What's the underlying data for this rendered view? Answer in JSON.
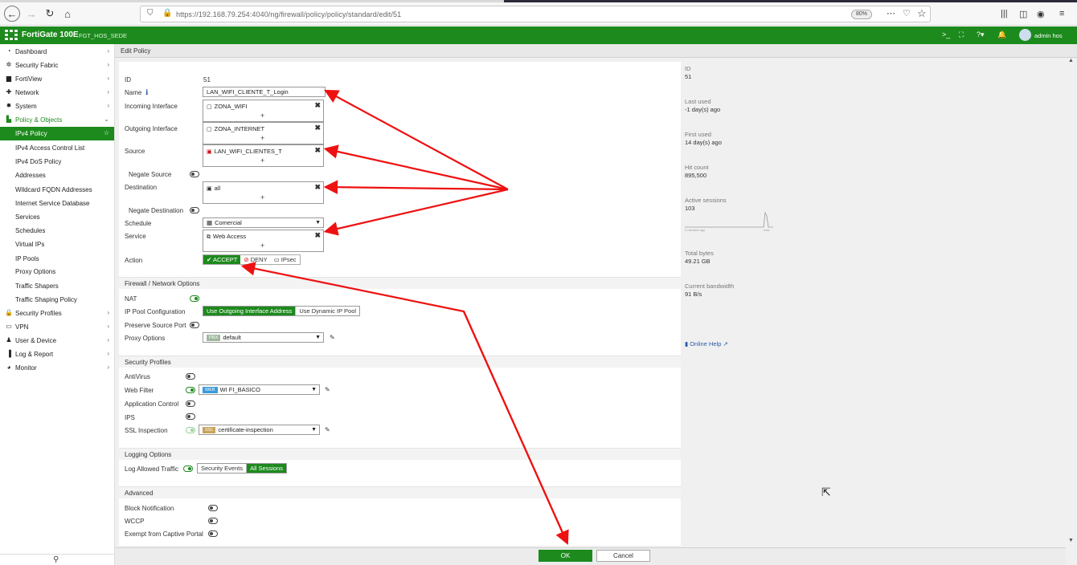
{
  "browser": {
    "url": "https://192.168.79.254:4040/ng/firewall/policy/policy/standard/edit/51",
    "zoom": "80%"
  },
  "header": {
    "model": "FortiGate 100E",
    "hostname": "FGT_HOS_SEDE",
    "user": "admin hos"
  },
  "sidebar": {
    "items": [
      {
        "label": "Dashboard",
        "icon": "dashboard-icon"
      },
      {
        "label": "Security Fabric",
        "icon": "fabric-icon"
      },
      {
        "label": "FortiView",
        "icon": "fortiview-icon"
      },
      {
        "label": "Network",
        "icon": "network-icon"
      },
      {
        "label": "System",
        "icon": "gear-icon"
      },
      {
        "label": "Policy & Objects",
        "icon": "policy-icon"
      },
      {
        "label": "IPv4 Policy"
      },
      {
        "label": "IPv4 Access Control List"
      },
      {
        "label": "IPv4 DoS Policy"
      },
      {
        "label": "Addresses"
      },
      {
        "label": "Wildcard FQDN Addresses"
      },
      {
        "label": "Internet Service Database"
      },
      {
        "label": "Services"
      },
      {
        "label": "Schedules"
      },
      {
        "label": "Virtual IPs"
      },
      {
        "label": "IP Pools"
      },
      {
        "label": "Proxy Options"
      },
      {
        "label": "Traffic Shapers"
      },
      {
        "label": "Traffic Shaping Policy"
      },
      {
        "label": "Security Profiles",
        "icon": "lock-icon"
      },
      {
        "label": "VPN",
        "icon": "vpn-icon"
      },
      {
        "label": "User & Device",
        "icon": "user-icon"
      },
      {
        "label": "Log & Report",
        "icon": "chart-icon"
      },
      {
        "label": "Monitor",
        "icon": "monitor-icon"
      }
    ]
  },
  "page": {
    "title": "Edit Policy"
  },
  "form": {
    "id_label": "ID",
    "id_value": "51",
    "name_label": "Name",
    "name_value": "LAN_WIFI_CLIENTE_T_Login",
    "incoming_label": "Incoming Interface",
    "incoming_value": "ZONA_WIFI",
    "outgoing_label": "Outgoing Interface",
    "outgoing_value": "ZONA_INTERNET",
    "source_label": "Source",
    "source_value": "LAN_WIFI_CLIENTES_T",
    "negate_source_label": "Negate Source",
    "destination_label": "Destination",
    "destination_value": "all",
    "negate_destination_label": "Negate Destination",
    "schedule_label": "Schedule",
    "schedule_value": "Comercial",
    "service_label": "Service",
    "service_value": "Web Access",
    "action_label": "Action",
    "action_accept": "ACCEPT",
    "action_deny": "DENY",
    "action_ipsec": "IPsec",
    "plus": "+",
    "remove": "✖"
  },
  "firewall": {
    "section": "Firewall / Network Options",
    "nat_label": "NAT",
    "ippool_label": "IP Pool Configuration",
    "ippool_opt1": "Use Outgoing Interface Address",
    "ippool_opt2": "Use Dynamic IP Pool",
    "preserve_label": "Preserve Source Port",
    "proxy_label": "Proxy Options",
    "proxy_badge": "PRX",
    "proxy_value": "default"
  },
  "security": {
    "section": "Security Profiles",
    "antivirus_label": "AntiVirus",
    "webfilter_label": "Web Filter",
    "webfilter_badge": "WEB",
    "webfilter_value": "WI FI_BASICO",
    "appcontrol_label": "Application Control",
    "ips_label": "IPS",
    "ssl_label": "SSL Inspection",
    "ssl_badge": "SSL",
    "ssl_value": "certificate-inspection"
  },
  "logging": {
    "section": "Logging Options",
    "allowed_label": "Log Allowed Traffic",
    "opt1": "Security Events",
    "opt2": "All Sessions"
  },
  "advanced": {
    "section": "Advanced",
    "block_label": "Block Notification",
    "wccp_label": "WCCP",
    "exempt_label": "Exempt from Captive Portal"
  },
  "stats": {
    "id_label": "ID",
    "id_value": "51",
    "last_used_label": "Last used",
    "last_used_value": "-1 day(s) ago",
    "first_used_label": "First used",
    "first_used_value": "14 day(s) ago",
    "hit_label": "Hit count",
    "hit_value": "895,500",
    "sessions_label": "Active sessions",
    "sessions_value": "103",
    "spark_left": "2 minutes ago",
    "spark_right": "now",
    "bytes_label": "Total bytes",
    "bytes_value": "49.21 GB",
    "bandwidth_label": "Current bandwidth",
    "bandwidth_value": "91 B/s",
    "help": "Online Help"
  },
  "footer": {
    "ok": "OK",
    "cancel": "Cancel"
  },
  "colors": {
    "brand": "#1d8a1d",
    "annotation": "#ee1111"
  }
}
